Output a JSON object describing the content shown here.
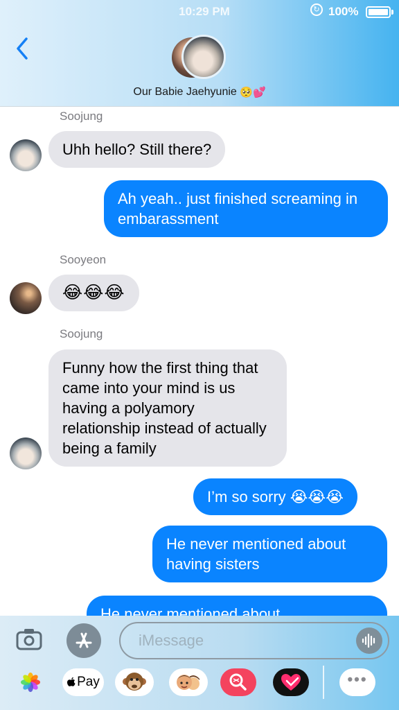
{
  "status": {
    "time": "10:29 PM",
    "battery": "100%"
  },
  "header": {
    "group_name": "Our Babie Jaehyunie",
    "group_emojis": "🥺💕"
  },
  "messages": [
    {
      "sender": "Soojung",
      "direction": "in",
      "text": "Uhh hello? Still there?"
    },
    {
      "direction": "out",
      "text": "Ah yeah.. just finished screaming in embarassment"
    },
    {
      "sender": "Sooyeon",
      "direction": "in",
      "text": "😂😂😂"
    },
    {
      "sender": "Soojung",
      "direction": "in",
      "text": "Funny how the first thing that came into your mind is us having a polyamory relationship instead of actually being a family"
    },
    {
      "direction": "out",
      "text": "I’m so sorry 😭😭😭"
    },
    {
      "direction": "out",
      "text": "He never mentioned about having sisters"
    },
    {
      "direction": "out",
      "text": "He never mentioned about"
    }
  ],
  "input": {
    "placeholder": "iMessage"
  },
  "app_drawer": {
    "apple_pay_label": "Pay",
    "icons": [
      "photos-icon",
      "apple-pay-icon",
      "monkey-animoji-icon",
      "memoji-icon",
      "image-search-icon",
      "digital-touch-icon",
      "more-icon"
    ]
  },
  "colors": {
    "outgoing_bubble": "#0a84ff",
    "incoming_bubble": "#e5e5ea"
  }
}
